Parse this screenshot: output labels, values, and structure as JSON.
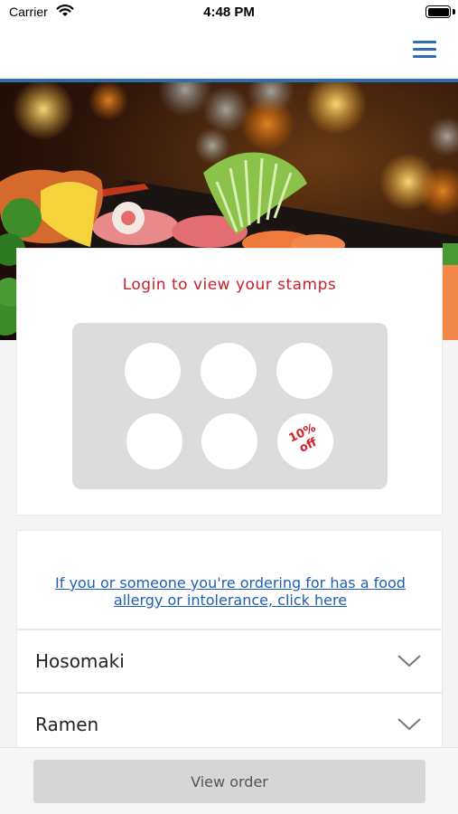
{
  "status_bar": {
    "carrier": "Carrier",
    "time": "4:48 PM"
  },
  "header": {
    "menu_icon": "hamburger-menu-icon",
    "accent_color": "#2c6db6"
  },
  "hero": {
    "image": "sushi-platter-photo"
  },
  "stamp_card": {
    "title": "Login to view your stamps",
    "title_color": "#c8202a",
    "stamp_count": 6,
    "reward_text_line1": "10%",
    "reward_text_line2": "off"
  },
  "allergy_notice": {
    "link_text": "If you or someone you're ordering for has a food allergy or intolerance, click here",
    "link_color": "#1f5fb3"
  },
  "categories": [
    {
      "label": "Hosomaki",
      "icon": "chevron-down-icon"
    },
    {
      "label": "Ramen",
      "icon": "chevron-down-icon"
    }
  ],
  "bottom_bar": {
    "view_order_label": "View order"
  }
}
